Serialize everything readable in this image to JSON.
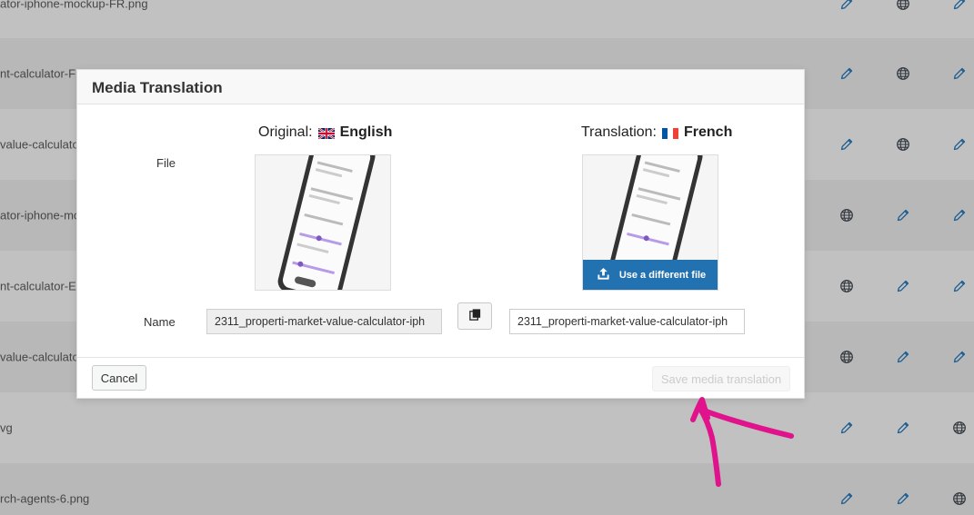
{
  "background": {
    "rows": [
      {
        "name": "ator-iphone-mockup-FR.png",
        "icons": [
          "pencil-icon",
          "globe-icon",
          "pencil-icon"
        ]
      },
      {
        "name": "nt-calculator-FR",
        "icons": [
          "pencil-icon",
          "globe-icon",
          "pencil-icon"
        ]
      },
      {
        "name": "value-calculator-",
        "icons": [
          "pencil-icon",
          "globe-icon",
          "pencil-icon"
        ]
      },
      {
        "name": "ator-iphone-mo",
        "icons": [
          "globe-icon",
          "pencil-icon",
          "pencil-icon"
        ]
      },
      {
        "name": "nt-calculator-EN",
        "icons": [
          "globe-icon",
          "pencil-icon",
          "pencil-icon"
        ]
      },
      {
        "name": "value-calculator-",
        "icons": [
          "globe-icon",
          "pencil-icon",
          "pencil-icon"
        ]
      },
      {
        "name": "vg",
        "icons": [
          "pencil-icon",
          "pencil-icon",
          "globe-icon"
        ]
      },
      {
        "name": "rch-agents-6.png",
        "icons": [
          "pencil-icon",
          "pencil-icon",
          "globe-icon"
        ]
      }
    ]
  },
  "modal": {
    "title": "Media Translation",
    "original_label": "Original:",
    "original_lang": "English",
    "translation_label": "Translation:",
    "translation_lang": "French",
    "file_label": "File",
    "name_label": "Name",
    "use_different_file": "Use a different file",
    "original_name": "2311_properti-market-value-calculator-iph",
    "translated_name": "2311_properti-market-value-calculator-iph",
    "cancel_label": "Cancel",
    "save_label": "Save media translation"
  },
  "colors": {
    "accent": "#2271b1",
    "annotation": "#e0128c"
  }
}
